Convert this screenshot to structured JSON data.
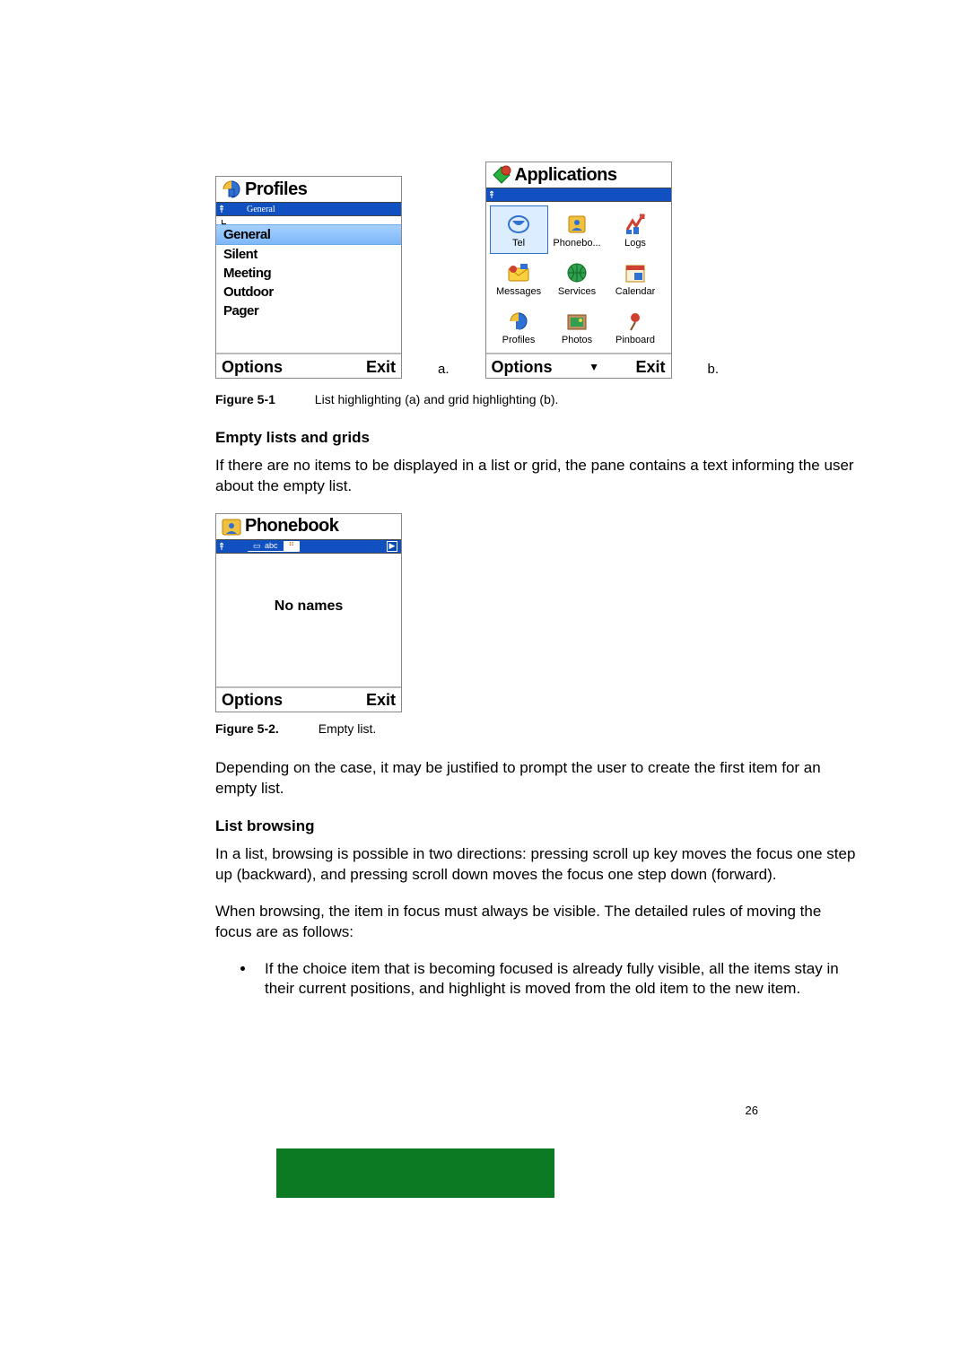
{
  "screen_a": {
    "title": "Profiles",
    "status_label": "General",
    "items": [
      "General",
      "Silent",
      "Meeting",
      "Outdoor",
      "Pager"
    ],
    "selected_index": 0,
    "softkey_left": "Options",
    "softkey_right": "Exit"
  },
  "screen_b": {
    "title": "Applications",
    "grid": [
      [
        {
          "label": "Tel",
          "icon": "tel"
        },
        {
          "label": "Phonebo...",
          "icon": "phonebook"
        },
        {
          "label": "Logs",
          "icon": "logs"
        }
      ],
      [
        {
          "label": "Messages",
          "icon": "messages"
        },
        {
          "label": "Services",
          "icon": "services"
        },
        {
          "label": "Calendar",
          "icon": "calendar"
        }
      ],
      [
        {
          "label": "Profiles",
          "icon": "profiles"
        },
        {
          "label": "Photos",
          "icon": "photos"
        },
        {
          "label": "Pinboard",
          "icon": "pinboard"
        }
      ]
    ],
    "selected": [
      0,
      0
    ],
    "softkey_left": "Options",
    "softkey_right": "Exit",
    "softkey_center_icon": "▼"
  },
  "screen_c": {
    "title": "Phonebook",
    "tab_left": "abc",
    "tab_right_icon": "groups",
    "empty_text": "No names",
    "softkey_left": "Options",
    "softkey_right": "Exit"
  },
  "figure_letters": {
    "a": "a.",
    "b": "b."
  },
  "fig1_label": "Figure 5-1",
  "fig1_caption": "List highlighting (a) and grid highlighting (b).",
  "section1_heading": "Empty lists and grids",
  "section1_p1": "If there are no items to be displayed in a list or grid, the pane contains a text informing the user about the empty list.",
  "fig2_label": "Figure 5-2.",
  "fig2_caption": "Empty list.",
  "section1_p2": "Depending on the case, it may be justified to prompt the user to create the first item for an empty list.",
  "section2_heading": "List browsing",
  "section2_p1": "In a list, browsing is possible in two directions:  pressing scroll up key moves the focus one step up (backward), and pressing scroll down moves the focus one step down (forward).",
  "section2_p2": "When browsing, the item in focus must always be visible. The detailed rules of moving the focus are as follows:",
  "section2_bullet1": "If the choice item that is becoming focused is already fully visible, all the items stay in their current positions, and highlight is moved from the old item to the new item.",
  "page_number": "26"
}
